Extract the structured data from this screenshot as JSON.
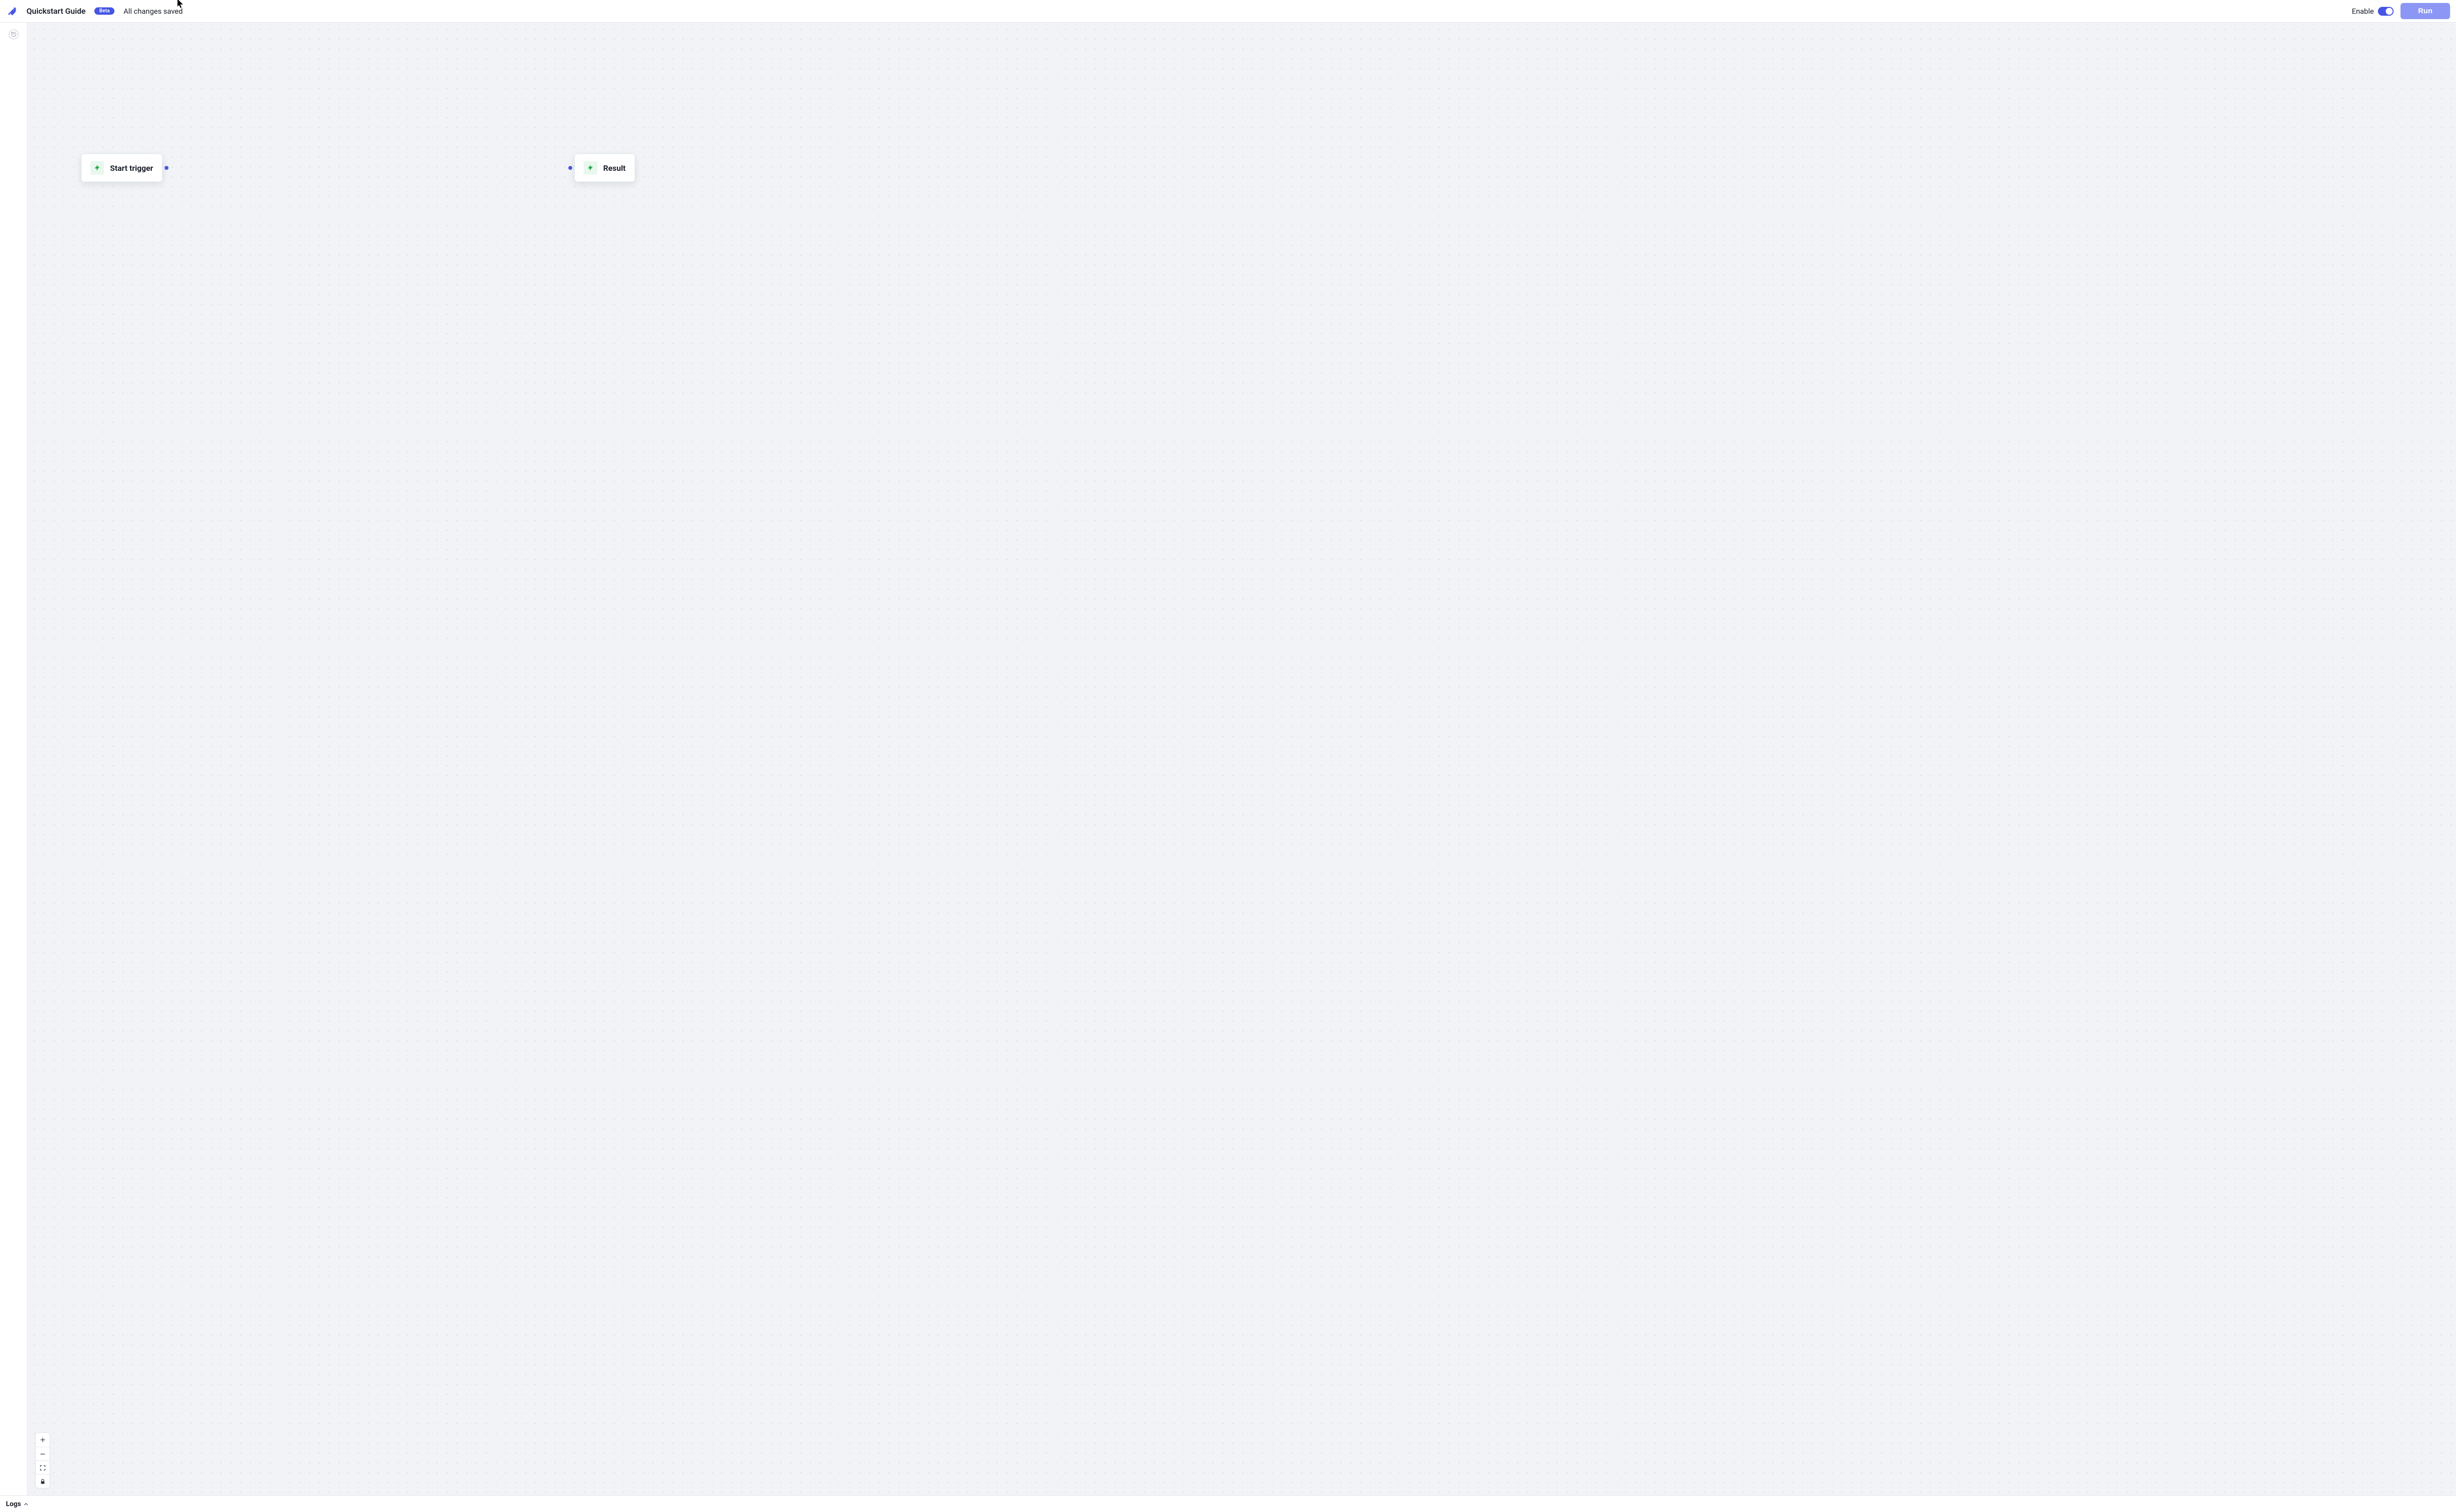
{
  "header": {
    "title": "Quickstart Guide",
    "badge": "Beta",
    "save_status": "All changes saved",
    "enable_label": "Enable",
    "enable_on": true,
    "run_label": "Run"
  },
  "siderail": {
    "history_tooltip": "History"
  },
  "canvas": {
    "nodes": {
      "start": {
        "label": "Start trigger"
      },
      "result": {
        "label": "Result"
      }
    }
  },
  "zoom": {
    "zoom_in": "Zoom in",
    "zoom_out": "Zoom out",
    "fit": "Fit view",
    "lock": "Lock view"
  },
  "logs": {
    "label": "Logs",
    "expanded": false
  },
  "colors": {
    "indigo": "#4756e3",
    "indigo_light": "#8c97f5",
    "green": "#28a745"
  }
}
